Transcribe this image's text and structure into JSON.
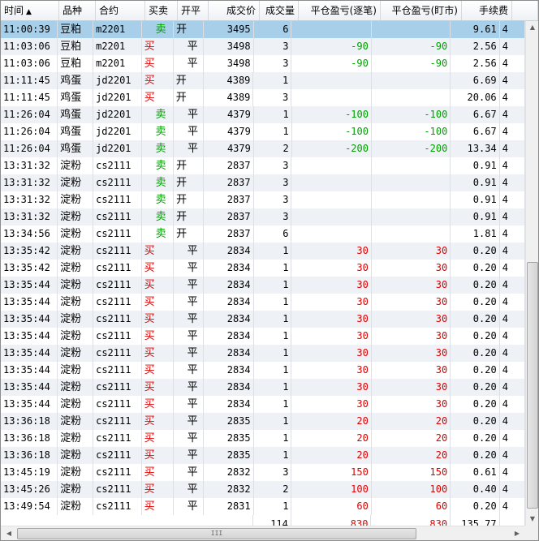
{
  "colors": {
    "buy": "#e00000",
    "sell": "#00a000",
    "profit": "#e00000",
    "loss": "#00a000",
    "selected": "#a7cfe9"
  },
  "header": {
    "columns": [
      "时间",
      "品种",
      "合约",
      "买卖",
      "开平",
      "成交价",
      "成交量",
      "平仓盈亏(逐笔)",
      "平仓盈亏(盯市)",
      "手续费",
      ""
    ],
    "sort_indicator": "▲"
  },
  "rows": [
    {
      "time": "11:00:39",
      "product": "豆粕",
      "contract": "m2201",
      "side": "卖",
      "oc": "开",
      "price": "3495",
      "qty": "6",
      "pnl_trade": "",
      "pnl_mtm": "",
      "fee": "9.61",
      "extra": "4"
    },
    {
      "time": "11:03:06",
      "product": "豆粕",
      "contract": "m2201",
      "side": "买",
      "oc": "平",
      "price": "3498",
      "qty": "3",
      "pnl_trade": "-90",
      "pnl_mtm": "-90",
      "fee": "2.56",
      "extra": "4"
    },
    {
      "time": "11:03:06",
      "product": "豆粕",
      "contract": "m2201",
      "side": "买",
      "oc": "平",
      "price": "3498",
      "qty": "3",
      "pnl_trade": "-90",
      "pnl_mtm": "-90",
      "fee": "2.56",
      "extra": "4"
    },
    {
      "time": "11:11:45",
      "product": "鸡蛋",
      "contract": "jd2201",
      "side": "买",
      "oc": "开",
      "price": "4389",
      "qty": "1",
      "pnl_trade": "",
      "pnl_mtm": "",
      "fee": "6.69",
      "extra": "4"
    },
    {
      "time": "11:11:45",
      "product": "鸡蛋",
      "contract": "jd2201",
      "side": "买",
      "oc": "开",
      "price": "4389",
      "qty": "3",
      "pnl_trade": "",
      "pnl_mtm": "",
      "fee": "20.06",
      "extra": "4"
    },
    {
      "time": "11:26:04",
      "product": "鸡蛋",
      "contract": "jd2201",
      "side": "卖",
      "oc": "平",
      "price": "4379",
      "qty": "1",
      "pnl_trade": "-100",
      "pnl_mtm": "-100",
      "fee": "6.67",
      "extra": "4"
    },
    {
      "time": "11:26:04",
      "product": "鸡蛋",
      "contract": "jd2201",
      "side": "卖",
      "oc": "平",
      "price": "4379",
      "qty": "1",
      "pnl_trade": "-100",
      "pnl_mtm": "-100",
      "fee": "6.67",
      "extra": "4"
    },
    {
      "time": "11:26:04",
      "product": "鸡蛋",
      "contract": "jd2201",
      "side": "卖",
      "oc": "平",
      "price": "4379",
      "qty": "2",
      "pnl_trade": "-200",
      "pnl_mtm": "-200",
      "fee": "13.34",
      "extra": "4"
    },
    {
      "time": "13:31:32",
      "product": "淀粉",
      "contract": "cs2111",
      "side": "卖",
      "oc": "开",
      "price": "2837",
      "qty": "3",
      "pnl_trade": "",
      "pnl_mtm": "",
      "fee": "0.91",
      "extra": "4"
    },
    {
      "time": "13:31:32",
      "product": "淀粉",
      "contract": "cs2111",
      "side": "卖",
      "oc": "开",
      "price": "2837",
      "qty": "3",
      "pnl_trade": "",
      "pnl_mtm": "",
      "fee": "0.91",
      "extra": "4"
    },
    {
      "time": "13:31:32",
      "product": "淀粉",
      "contract": "cs2111",
      "side": "卖",
      "oc": "开",
      "price": "2837",
      "qty": "3",
      "pnl_trade": "",
      "pnl_mtm": "",
      "fee": "0.91",
      "extra": "4"
    },
    {
      "time": "13:31:32",
      "product": "淀粉",
      "contract": "cs2111",
      "side": "卖",
      "oc": "开",
      "price": "2837",
      "qty": "3",
      "pnl_trade": "",
      "pnl_mtm": "",
      "fee": "0.91",
      "extra": "4"
    },
    {
      "time": "13:34:56",
      "product": "淀粉",
      "contract": "cs2111",
      "side": "卖",
      "oc": "开",
      "price": "2837",
      "qty": "6",
      "pnl_trade": "",
      "pnl_mtm": "",
      "fee": "1.81",
      "extra": "4"
    },
    {
      "time": "13:35:42",
      "product": "淀粉",
      "contract": "cs2111",
      "side": "买",
      "oc": "平",
      "price": "2834",
      "qty": "1",
      "pnl_trade": "30",
      "pnl_mtm": "30",
      "fee": "0.20",
      "extra": "4"
    },
    {
      "time": "13:35:42",
      "product": "淀粉",
      "contract": "cs2111",
      "side": "买",
      "oc": "平",
      "price": "2834",
      "qty": "1",
      "pnl_trade": "30",
      "pnl_mtm": "30",
      "fee": "0.20",
      "extra": "4"
    },
    {
      "time": "13:35:44",
      "product": "淀粉",
      "contract": "cs2111",
      "side": "买",
      "oc": "平",
      "price": "2834",
      "qty": "1",
      "pnl_trade": "30",
      "pnl_mtm": "30",
      "fee": "0.20",
      "extra": "4"
    },
    {
      "time": "13:35:44",
      "product": "淀粉",
      "contract": "cs2111",
      "side": "买",
      "oc": "平",
      "price": "2834",
      "qty": "1",
      "pnl_trade": "30",
      "pnl_mtm": "30",
      "fee": "0.20",
      "extra": "4"
    },
    {
      "time": "13:35:44",
      "product": "淀粉",
      "contract": "cs2111",
      "side": "买",
      "oc": "平",
      "price": "2834",
      "qty": "1",
      "pnl_trade": "30",
      "pnl_mtm": "30",
      "fee": "0.20",
      "extra": "4"
    },
    {
      "time": "13:35:44",
      "product": "淀粉",
      "contract": "cs2111",
      "side": "买",
      "oc": "平",
      "price": "2834",
      "qty": "1",
      "pnl_trade": "30",
      "pnl_mtm": "30",
      "fee": "0.20",
      "extra": "4"
    },
    {
      "time": "13:35:44",
      "product": "淀粉",
      "contract": "cs2111",
      "side": "买",
      "oc": "平",
      "price": "2834",
      "qty": "1",
      "pnl_trade": "30",
      "pnl_mtm": "30",
      "fee": "0.20",
      "extra": "4"
    },
    {
      "time": "13:35:44",
      "product": "淀粉",
      "contract": "cs2111",
      "side": "买",
      "oc": "平",
      "price": "2834",
      "qty": "1",
      "pnl_trade": "30",
      "pnl_mtm": "30",
      "fee": "0.20",
      "extra": "4"
    },
    {
      "time": "13:35:44",
      "product": "淀粉",
      "contract": "cs2111",
      "side": "买",
      "oc": "平",
      "price": "2834",
      "qty": "1",
      "pnl_trade": "30",
      "pnl_mtm": "30",
      "fee": "0.20",
      "extra": "4"
    },
    {
      "time": "13:35:44",
      "product": "淀粉",
      "contract": "cs2111",
      "side": "买",
      "oc": "平",
      "price": "2834",
      "qty": "1",
      "pnl_trade": "30",
      "pnl_mtm": "30",
      "fee": "0.20",
      "extra": "4"
    },
    {
      "time": "13:36:18",
      "product": "淀粉",
      "contract": "cs2111",
      "side": "买",
      "oc": "平",
      "price": "2835",
      "qty": "1",
      "pnl_trade": "20",
      "pnl_mtm": "20",
      "fee": "0.20",
      "extra": "4"
    },
    {
      "time": "13:36:18",
      "product": "淀粉",
      "contract": "cs2111",
      "side": "买",
      "oc": "平",
      "price": "2835",
      "qty": "1",
      "pnl_trade": "20",
      "pnl_mtm": "20",
      "fee": "0.20",
      "extra": "4"
    },
    {
      "time": "13:36:18",
      "product": "淀粉",
      "contract": "cs2111",
      "side": "买",
      "oc": "平",
      "price": "2835",
      "qty": "1",
      "pnl_trade": "20",
      "pnl_mtm": "20",
      "fee": "0.20",
      "extra": "4"
    },
    {
      "time": "13:45:19",
      "product": "淀粉",
      "contract": "cs2111",
      "side": "买",
      "oc": "平",
      "price": "2832",
      "qty": "3",
      "pnl_trade": "150",
      "pnl_mtm": "150",
      "fee": "0.61",
      "extra": "4"
    },
    {
      "time": "13:45:26",
      "product": "淀粉",
      "contract": "cs2111",
      "side": "买",
      "oc": "平",
      "price": "2832",
      "qty": "2",
      "pnl_trade": "100",
      "pnl_mtm": "100",
      "fee": "0.40",
      "extra": "4"
    },
    {
      "time": "13:49:54",
      "product": "淀粉",
      "contract": "cs2111",
      "side": "买",
      "oc": "平",
      "price": "2831",
      "qty": "1",
      "pnl_trade": "60",
      "pnl_mtm": "60",
      "fee": "0.20",
      "extra": "4"
    }
  ],
  "summary": {
    "qty": "114",
    "pnl_trade": "830",
    "pnl_mtm": "830",
    "fee": "135.77"
  },
  "scrollbars": {
    "up": "▲",
    "down": "▼",
    "left": "◀",
    "right": "▶",
    "grip": "III"
  }
}
